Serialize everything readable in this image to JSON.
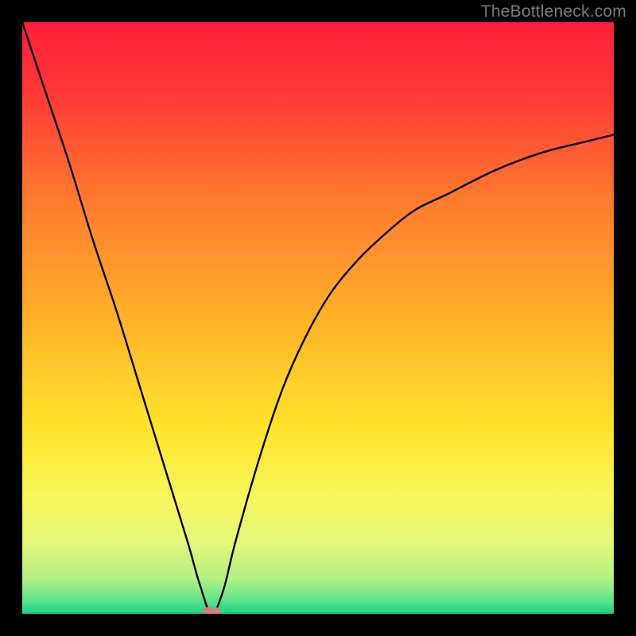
{
  "watermark": "TheBottleneck.com",
  "chart_data": {
    "type": "line",
    "title": "",
    "xlabel": "",
    "ylabel": "",
    "xlim": [
      0,
      100
    ],
    "ylim": [
      0,
      100
    ],
    "grid": false,
    "legend": false,
    "notes": "Bottleneck-style V-curve over a vertical red→orange→yellow→green gradient background. The single black curve descends steeply from the top-left, reaches a minimum near the bottom around x≈32, then rises asymptotically toward the right side. A small rounded pink marker sits at the curve minimum on the baseline.",
    "series": [
      {
        "name": "bottleneck-curve",
        "color": "#000000",
        "x": [
          0,
          4,
          8,
          12,
          16,
          20,
          24,
          28,
          30,
          32,
          34,
          36,
          40,
          44,
          48,
          52,
          56,
          60,
          66,
          72,
          80,
          88,
          96,
          100
        ],
        "values": [
          100,
          88,
          76,
          63,
          51,
          38,
          25,
          12,
          5,
          0,
          4,
          12,
          26,
          38,
          47,
          54,
          59,
          63,
          68,
          71,
          75,
          78,
          80,
          81
        ]
      }
    ],
    "marker": {
      "x": 32,
      "y": 0,
      "color": "#d97c80"
    },
    "background_gradient": {
      "direction": "vertical",
      "stops": [
        {
          "pos": 0.0,
          "color": "#ff1f3a"
        },
        {
          "pos": 0.12,
          "color": "#ff3838"
        },
        {
          "pos": 0.3,
          "color": "#ff7a2e"
        },
        {
          "pos": 0.5,
          "color": "#ffb129"
        },
        {
          "pos": 0.68,
          "color": "#ffe22a"
        },
        {
          "pos": 0.8,
          "color": "#f8f65a"
        },
        {
          "pos": 0.88,
          "color": "#e5f77a"
        },
        {
          "pos": 0.94,
          "color": "#b3f082"
        },
        {
          "pos": 0.975,
          "color": "#65e58a"
        },
        {
          "pos": 1.0,
          "color": "#17d28a"
        }
      ]
    }
  }
}
